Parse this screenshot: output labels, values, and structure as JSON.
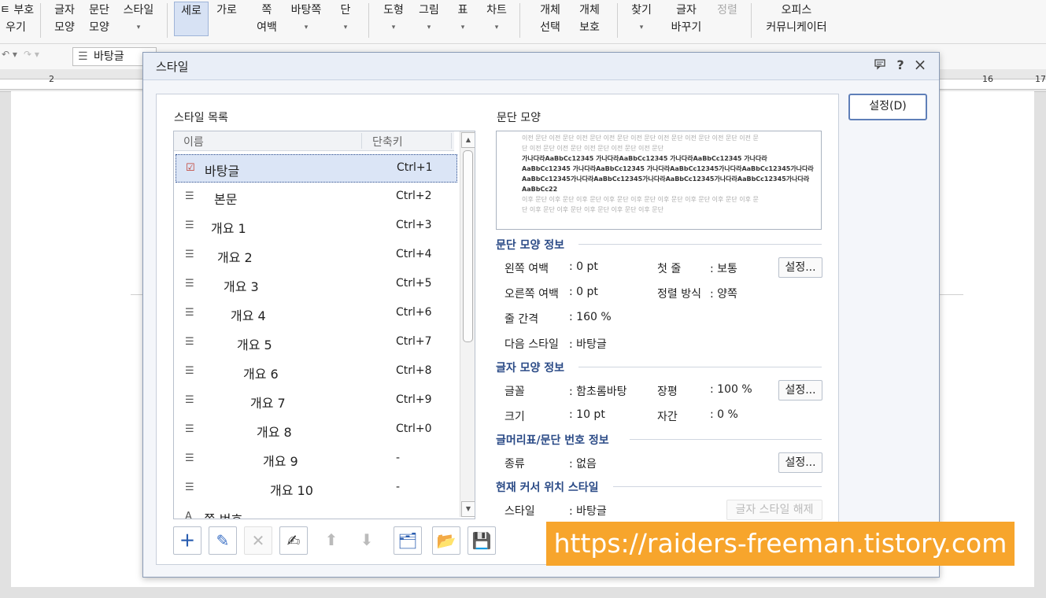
{
  "ribbon": {
    "items": [
      {
        "l1": "ㅌ 부호",
        "l2": "우기"
      },
      {
        "l1": "글자",
        "l2": "모양"
      },
      {
        "l1": "문단",
        "l2": "모양"
      },
      {
        "l1": "스타일",
        "l2": ""
      },
      {
        "l1": "세로",
        "l2": ""
      },
      {
        "l1": "가로",
        "l2": ""
      },
      {
        "l1": "쪽",
        "l2": "여백"
      },
      {
        "l1": "바탕쪽",
        "l2": ""
      },
      {
        "l1": "단",
        "l2": ""
      },
      {
        "l1": "도형",
        "l2": ""
      },
      {
        "l1": "그림",
        "l2": ""
      },
      {
        "l1": "표",
        "l2": ""
      },
      {
        "l1": "차트",
        "l2": ""
      },
      {
        "l1": "개체",
        "l2": "선택"
      },
      {
        "l1": "개체",
        "l2": "보호"
      },
      {
        "l1": "찾기",
        "l2": ""
      },
      {
        "l1": "글자",
        "l2": "바꾸기"
      },
      {
        "l1": "정렬",
        "l2": ""
      },
      {
        "l1": "오피스",
        "l2": "커뮤니케이터"
      }
    ],
    "style_select": "바탕글"
  },
  "ruler": {
    "marks": [
      "2",
      "16",
      "17"
    ]
  },
  "dialog": {
    "title": "스타일",
    "help": "?",
    "close": "×",
    "settings_button": "설정(D)",
    "style_list_label": "스타일 목록",
    "col_name": "이름",
    "col_shortcut": "단축키",
    "styles": [
      {
        "name": "바탕글",
        "shortcut": "Ctrl+1"
      },
      {
        "name": "본문",
        "shortcut": "Ctrl+2"
      },
      {
        "name": "개요 1",
        "shortcut": "Ctrl+3"
      },
      {
        "name": "개요 2",
        "shortcut": "Ctrl+4"
      },
      {
        "name": "개요 3",
        "shortcut": "Ctrl+5"
      },
      {
        "name": "개요 4",
        "shortcut": "Ctrl+6"
      },
      {
        "name": "개요 5",
        "shortcut": "Ctrl+7"
      },
      {
        "name": "개요 6",
        "shortcut": "Ctrl+8"
      },
      {
        "name": "개요 7",
        "shortcut": "Ctrl+9"
      },
      {
        "name": "개요 8",
        "shortcut": "Ctrl+0"
      },
      {
        "name": "개요 9",
        "shortcut": "-"
      },
      {
        "name": "개요 10",
        "shortcut": "-"
      },
      {
        "name": "쪽 번호",
        "shortcut": ""
      }
    ],
    "para_preview_label": "문단 모양",
    "preview": {
      "prev1": "이전 문단 이전 문단 이전 문단 이전 문단 이전 문단 이전 문단 이전 문단 이전 문단 이전 문",
      "prev2": "단 이전 문단 이전 문단 이전 문단 이전 문단 이전 문단",
      "cur1": "가나다라AaBbCc12345      가나다라AaBbCc12345      가나다라AaBbCc12345      가나다라",
      "cur2": "AaBbCc12345  가나다라AaBbCc12345  가나다라AaBbCc12345가나다라AaBbCc12345가나다라",
      "cur3": "AaBbCc12345가나다라AaBbCc12345가나다라AaBbCc12345가나다라AaBbCc12345가나다라",
      "cur4": "AaBbCc22",
      "next1": "이후 문단 이후 문단 이후 문단 이후 문단 이후 문단 이후 문단 이후 문단 이후 문단 이후 문",
      "next2": "단 이후 문단 이후 문단 이후 문단 이후 문단 이후 문단"
    },
    "para_info": {
      "title": "문단 모양 정보",
      "left_margin_label": "왼쪽 여백",
      "left_margin": ": 0 pt",
      "first_line_label": "첫 줄",
      "first_line": ": 보통",
      "right_margin_label": "오른쪽 여백",
      "right_margin": ": 0 pt",
      "align_label": "정렬 방식",
      "align": ": 양쪽",
      "line_spacing_label": "줄 간격",
      "line_spacing": ": 160 %",
      "next_style_label": "다음 스타일",
      "next_style": ": 바탕글",
      "button": "설정..."
    },
    "char_info": {
      "title": "글자 모양 정보",
      "font_label": "글꼴",
      "font": ": 함초롬바탕",
      "width_label": "장평",
      "width": ": 100 %",
      "size_label": "크기",
      "size": ": 10 pt",
      "spacing_label": "자간",
      "spacing": ": 0 %",
      "button": "설정..."
    },
    "bullet_info": {
      "title": "글머리표/문단 번호 정보",
      "type_label": "종류",
      "type": ": 없음",
      "button": "설정..."
    },
    "cursor_info": {
      "title": "현재 커서 위치 스타일",
      "style_label": "스타일",
      "style": ": 바탕글",
      "button": "글자 스타일 해제"
    }
  },
  "watermark": "https://raiders-freeman.tistory.com"
}
